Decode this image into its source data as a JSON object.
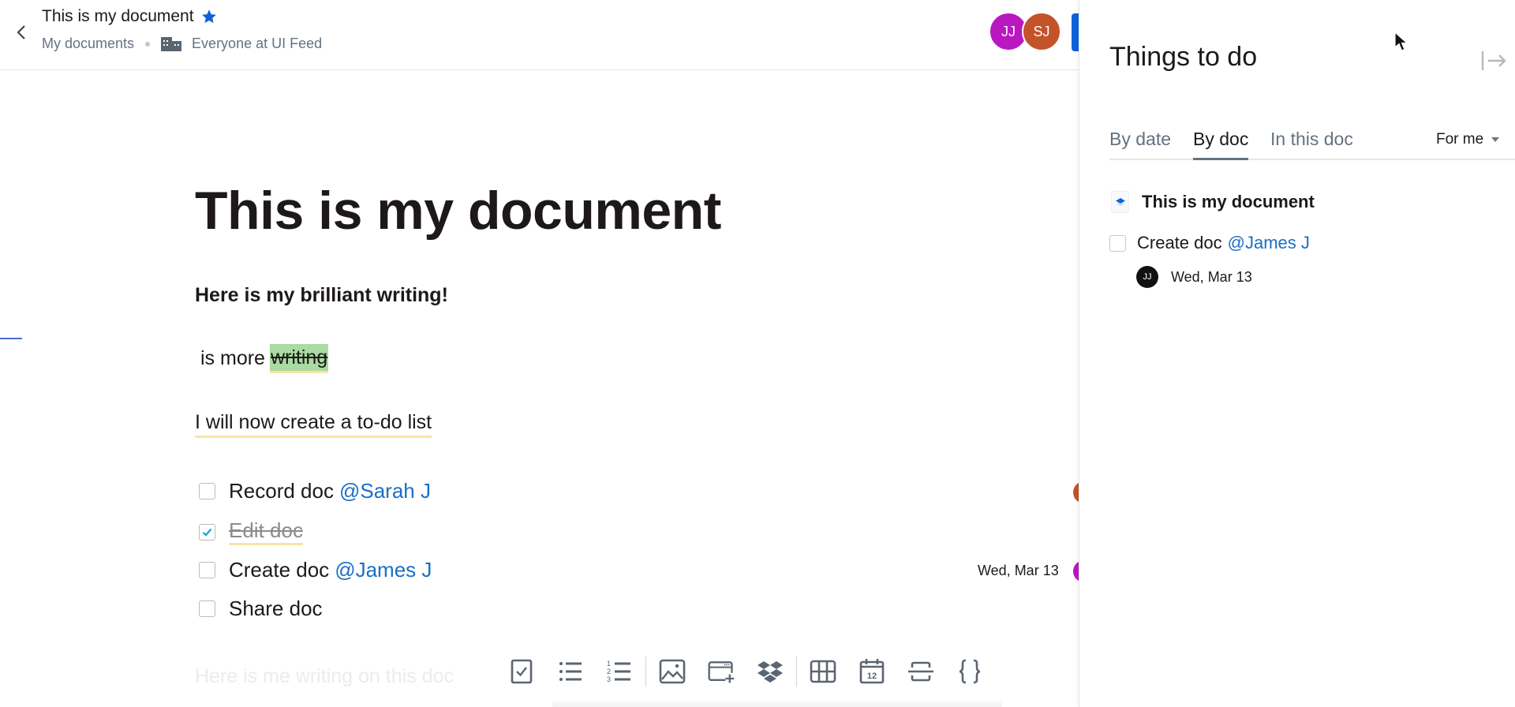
{
  "header": {
    "title": "This is my document",
    "starred": true,
    "breadcrumb": {
      "folder": "My documents",
      "audience": "Everyone at UI Feed"
    },
    "collaborators": [
      {
        "initials": "JJ",
        "color": "#b917c0"
      },
      {
        "initials": "SJ",
        "color": "#c4532a"
      }
    ],
    "accent_color": "#0f62d9"
  },
  "document": {
    "title": "This is my document",
    "paragraphs": {
      "bold": "Here is my brilliant writing!",
      "more_prefix": "is more",
      "more_highlight": "writing",
      "todo_intro": "I will now create a to-do list"
    },
    "todos": [
      {
        "text": "Record doc",
        "mention": "@Sarah J",
        "checked": false,
        "date": "",
        "assignee_color": "#c4532a"
      },
      {
        "text": "Edit doc",
        "mention": "",
        "checked": true,
        "date": ""
      },
      {
        "text": "Create doc",
        "mention": "@James J",
        "checked": false,
        "date": "Wed, Mar 13",
        "assignee_color": "#b917c0"
      },
      {
        "text": "Share doc",
        "mention": "",
        "checked": false,
        "date": ""
      }
    ],
    "placeholder_line": "Here is me writing on this doc"
  },
  "toolbar": {
    "items": [
      "checklist-icon",
      "bullet-list-icon",
      "numbered-list-icon",
      "image-icon",
      "embed-icon",
      "dropbox-icon",
      "table-icon",
      "calendar-icon",
      "divider-icon",
      "code-block-icon"
    ],
    "calendar_day": "12"
  },
  "panel": {
    "title": "Things to do",
    "tabs": [
      {
        "label": "By date",
        "active": false
      },
      {
        "label": "By doc",
        "active": true
      },
      {
        "label": "In this doc",
        "active": false
      }
    ],
    "filter": "For me",
    "group": {
      "title": "This is my document",
      "todo": {
        "text": "Create doc",
        "mention": "@James J",
        "assignee": "JJ",
        "date": "Wed, Mar 13"
      }
    }
  }
}
